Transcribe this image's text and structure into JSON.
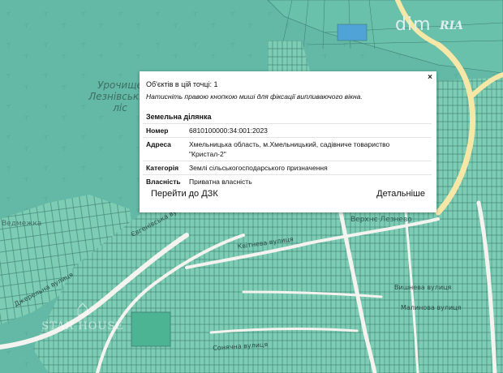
{
  "map": {
    "colors": {
      "forest": "#66bba7",
      "plot": "#7ccdb4",
      "plot_border": "#3c7b6d",
      "road": "#f5f3f0",
      "road_yellow": "#f6e7a6",
      "blue_plot": "#4fa3d6"
    },
    "labels": {
      "forest_line1": "Урочище",
      "forest_line2": "Лезнівський",
      "forest_line3": "ліс",
      "village": "Ведмежка",
      "settlement": "Верхнє Лезнево"
    },
    "streets": [
      "Джерельна вулиця",
      "Євгенівська вулиця",
      "Квітнева вулиця",
      "Вишнева вулиця",
      "Малинова вулиця",
      "Сонячна вулиця"
    ]
  },
  "logo": {
    "dim": "dim",
    "ria": "RIA"
  },
  "watermark": {
    "icon": "house-icon",
    "brand": "STAR HOUSE"
  },
  "popup": {
    "close_label": "×",
    "count_text": "Об'єктів в цій точці: 1",
    "hint_text": "Натисніть правою кнопкою миші для фіксації випливаючого вікна.",
    "section_title": "Земельна ділянка",
    "rows": [
      {
        "key": "Номер",
        "value": "6810100000:34:001:2023"
      },
      {
        "key": "Адреса",
        "value": "Хмельницька область, м.Хмельницький, садівниче товариство \"Кристал-2\""
      },
      {
        "key": "Категорія",
        "value": "Землі сільськогосподарського призначення"
      },
      {
        "key": "Власність",
        "value": "Приватна власність"
      }
    ],
    "button_left": "Перейти до ДЗК",
    "button_right": "Детальніше"
  }
}
